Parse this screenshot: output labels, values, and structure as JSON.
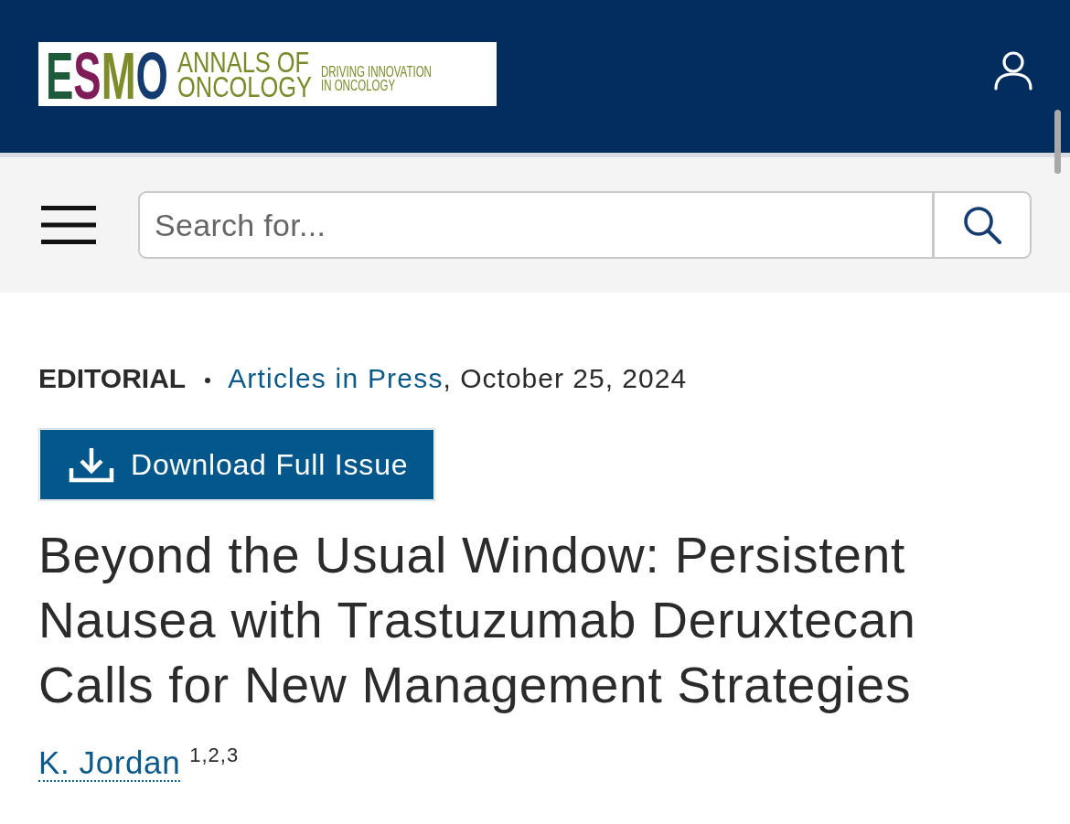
{
  "header": {
    "logo": {
      "letters": [
        {
          "text": "E",
          "color": "#1d5b3b"
        },
        {
          "text": "S",
          "color": "#7d1c57"
        },
        {
          "text": "M",
          "color": "#7f8c2c"
        },
        {
          "text": "O",
          "color": "#143c70"
        }
      ],
      "title_lines": [
        "ANNALS OF",
        "ONCOLOGY"
      ],
      "tagline_lines": [
        "DRIVING INNOVATION",
        "IN ONCOLOGY"
      ]
    }
  },
  "search": {
    "placeholder": "Search for..."
  },
  "article": {
    "type": "EDITORIAL",
    "collection": "Articles in Press",
    "date": ", October 25, 2024",
    "download_button": "Download Full Issue",
    "title": "Beyond the Usual Window: Persistent Nausea with Trastuzumab Deruxtecan Calls for New Management Strategies",
    "authors": [
      {
        "name": "K. Jordan",
        "affiliations": "1,2,3"
      }
    ]
  }
}
